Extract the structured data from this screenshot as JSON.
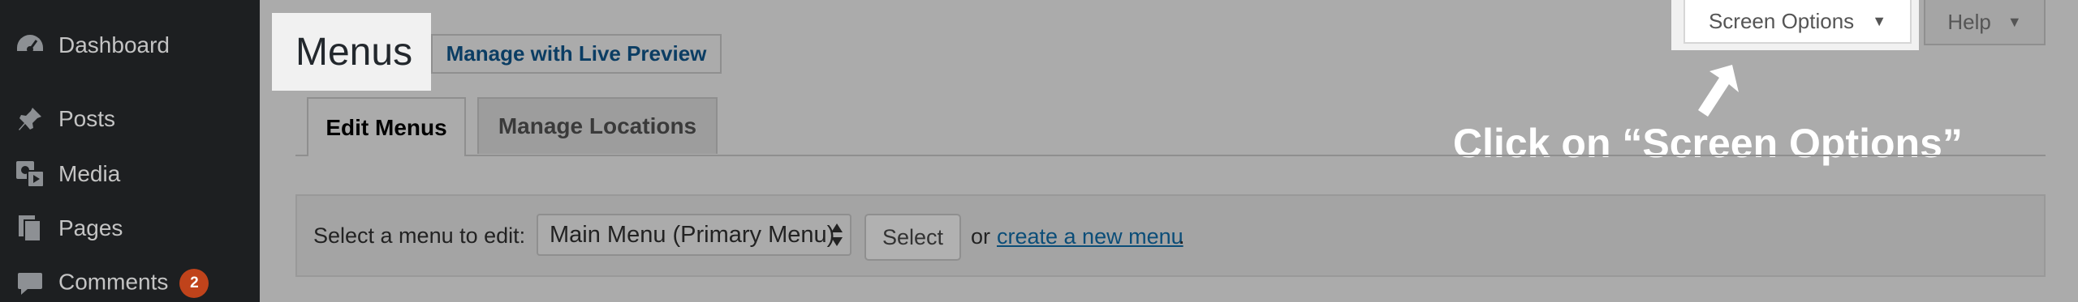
{
  "sidebar": {
    "items": [
      {
        "label": "Dashboard",
        "icon": "dashboard-icon"
      },
      {
        "label": "Posts",
        "icon": "pin-icon"
      },
      {
        "label": "Media",
        "icon": "media-icon"
      },
      {
        "label": "Pages",
        "icon": "pages-icon"
      },
      {
        "label": "Comments",
        "icon": "comment-icon",
        "badge": "2"
      }
    ]
  },
  "header": {
    "title": "Menus",
    "live_preview_label": "Manage with Live Preview"
  },
  "top_buttons": {
    "screen_options_label": "Screen Options",
    "help_label": "Help"
  },
  "tabs": [
    {
      "label": "Edit Menus",
      "active": true
    },
    {
      "label": "Manage Locations",
      "active": false
    }
  ],
  "annotation": {
    "text": "Click on “Screen Options”"
  },
  "menu_selector": {
    "label": "Select a menu to edit:",
    "selected": "Main Menu (Primary Menu)",
    "select_button": "Select",
    "or_text": "or",
    "create_link": "create a new menu",
    "period": "."
  },
  "colors": {
    "sidebar_bg": "#1d1f21",
    "badge": "#c0431b",
    "link": "#0b4d78",
    "overlay": "#ababab"
  }
}
